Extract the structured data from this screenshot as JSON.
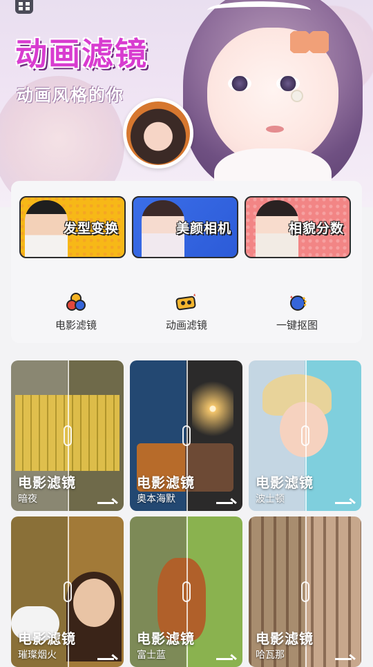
{
  "hero": {
    "title": "动画滤镜",
    "subtitle": "动画风格的你"
  },
  "features": [
    {
      "label": "发型变换",
      "color": "#f7b817"
    },
    {
      "label": "美颜相机",
      "color": "#3b6ee8"
    },
    {
      "label": "相貌分数",
      "color": "#f28585"
    }
  ],
  "tools": [
    {
      "label": "电影滤镜",
      "icon": "circles-icon"
    },
    {
      "label": "动画滤镜",
      "icon": "camera-emoji-icon"
    },
    {
      "label": "一键抠图",
      "icon": "cutout-icon"
    }
  ],
  "filters": [
    {
      "title": "电影滤镜",
      "name": "暗夜"
    },
    {
      "title": "电影滤镜",
      "name": "奥本海默"
    },
    {
      "title": "电影滤镜",
      "name": "波士顿"
    },
    {
      "title": "电影滤镜",
      "name": "璀璨烟火"
    },
    {
      "title": "电影滤镜",
      "name": "富士蓝"
    },
    {
      "title": "电影滤镜",
      "name": "哈瓦那"
    }
  ]
}
